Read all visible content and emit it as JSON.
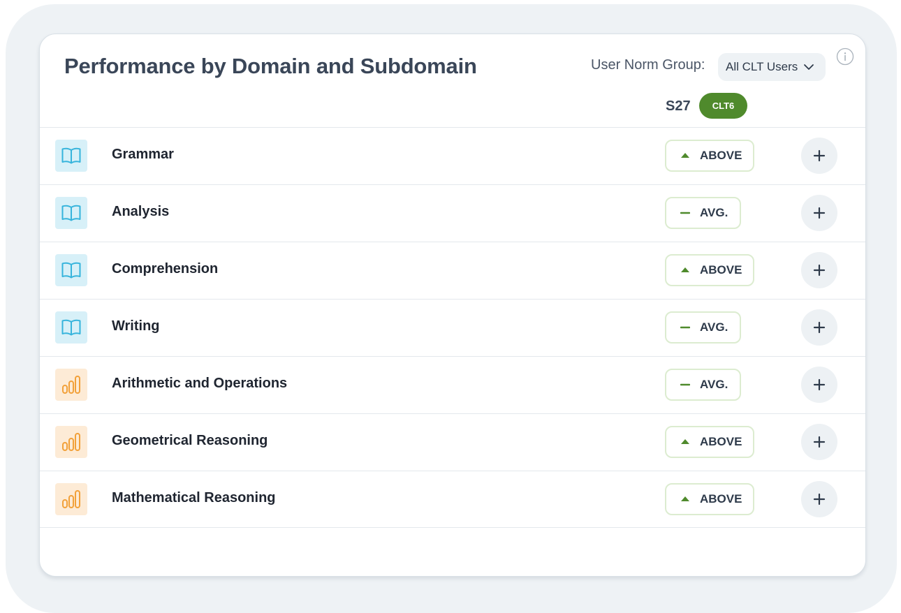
{
  "panel": {
    "title": "Performance by Domain and Subdomain",
    "norm_group_label": "User Norm Group:",
    "norm_group_value": "All CLT Users",
    "student_code": "S27",
    "test_badge": "CLT6"
  },
  "colors": {
    "accent_green": "#4f8a2c",
    "reading_icon": "#36b4dc",
    "math_icon": "#f2a13a"
  },
  "rows": [
    {
      "label": "Grammar",
      "icon": "open-book-icon",
      "category": "reading",
      "level": "above",
      "badge": "ABOVE"
    },
    {
      "label": "Analysis",
      "icon": "open-book-icon",
      "category": "reading",
      "level": "avg",
      "badge": "AVG."
    },
    {
      "label": "Comprehension",
      "icon": "open-book-icon",
      "category": "reading",
      "level": "above",
      "badge": "ABOVE"
    },
    {
      "label": "Writing",
      "icon": "open-book-icon",
      "category": "reading",
      "level": "avg",
      "badge": "AVG."
    },
    {
      "label": "Arithmetic and Operations",
      "icon": "bar-chart-icon",
      "category": "math",
      "level": "avg",
      "badge": "AVG."
    },
    {
      "label": "Geometrical Reasoning",
      "icon": "bar-chart-icon",
      "category": "math",
      "level": "above",
      "badge": "ABOVE"
    },
    {
      "label": "Mathematical Reasoning",
      "icon": "bar-chart-icon",
      "category": "math",
      "level": "above",
      "badge": "ABOVE"
    }
  ]
}
